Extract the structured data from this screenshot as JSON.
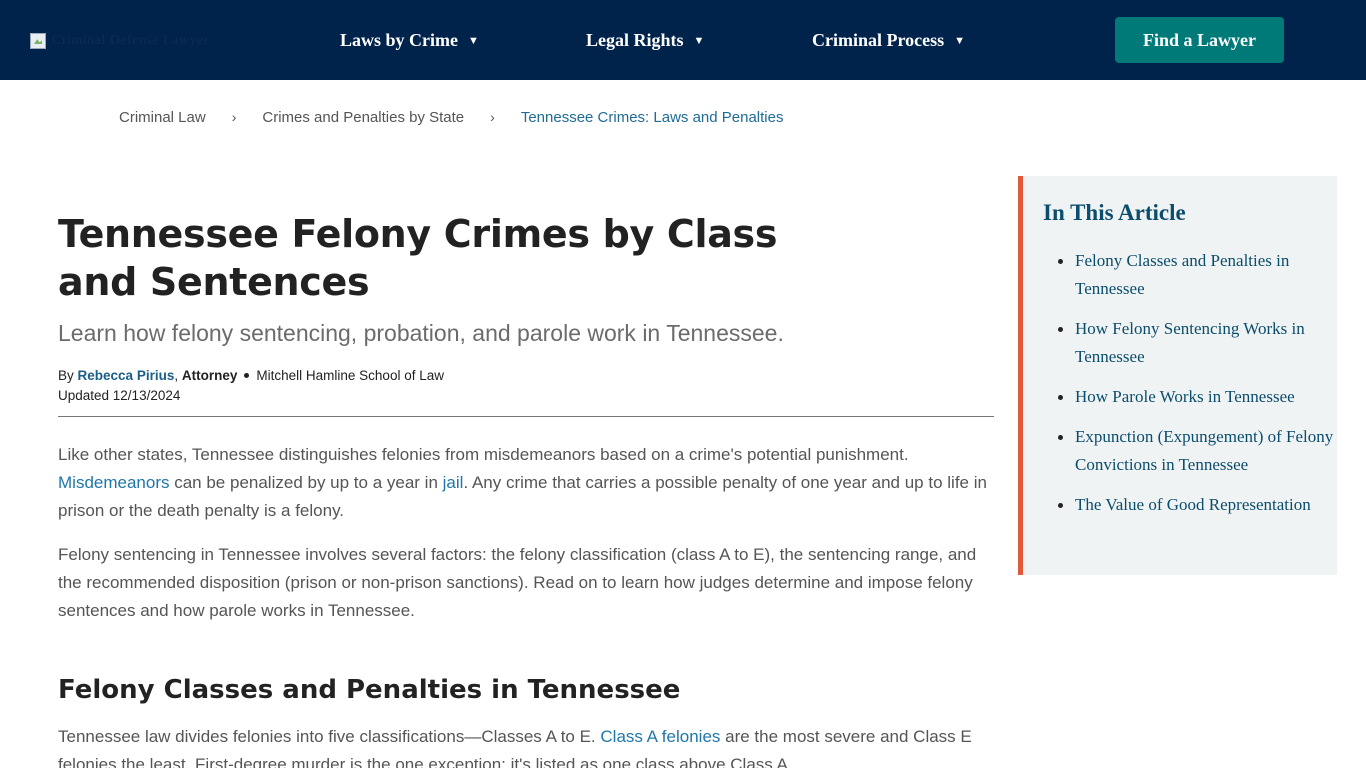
{
  "header": {
    "logo_alt": "Criminal Defense Lawyer",
    "nav": [
      {
        "label": "Laws by Crime"
      },
      {
        "label": "Legal Rights"
      },
      {
        "label": "Criminal Process"
      }
    ],
    "cta_label": "Find a Lawyer",
    "caret": "▼",
    "colors": {
      "background": "#00234b",
      "cta": "#007a78"
    }
  },
  "breadcrumb": {
    "items": [
      "Criminal Law",
      "Crimes and Penalties by State",
      "Tennessee Crimes: Laws and Penalties"
    ],
    "separator": "›"
  },
  "article": {
    "title": "Tennessee Felony Crimes by Class and Sentences",
    "subtitle": "Learn how felony sentencing, probation, and parole work in Tennessee.",
    "byline": {
      "by": "By",
      "author": "Rebecca Pirius",
      "comma": ",",
      "role": "Attorney",
      "school": "Mitchell Hamline School of Law"
    },
    "updated": "Updated 12/13/2024",
    "p1": {
      "a": "Like other states, Tennessee distinguishes felonies from misdemeanors based on a crime's potential punishment. ",
      "link1": "Misdemeanors",
      "b": " can be penalized by up to a year in ",
      "link2": "jail",
      "c": ". Any crime that carries a possible penalty of one year and up to life in prison or the death penalty is a felony."
    },
    "p2": "Felony sentencing in Tennessee involves several factors: the felony classification (class A to E), the sentencing range, and the recommended disposition (prison or non-prison sanctions). Read on to learn how judges determine and impose felony sentences and how parole works in Tennessee.",
    "h2": "Felony Classes and Penalties in Tennessee",
    "p3": {
      "a": "Tennessee law divides felonies into five classifications—Classes A to E. ",
      "link": "Class A felonies",
      "b": " are the most severe and Class E felonies the least. First-degree murder is the one exception; it's listed as one class above Class A."
    }
  },
  "toc": {
    "title": "In This Article",
    "items": [
      "Felony Classes and Penalties in Tennessee",
      "How Felony Sentencing Works in Tennessee",
      "How Parole Works in Tennessee",
      "Expunction (Expungement) of Felony Convictions in Tennessee",
      "The Value of Good Representation"
    ],
    "accent_color": "#e05a3a"
  }
}
